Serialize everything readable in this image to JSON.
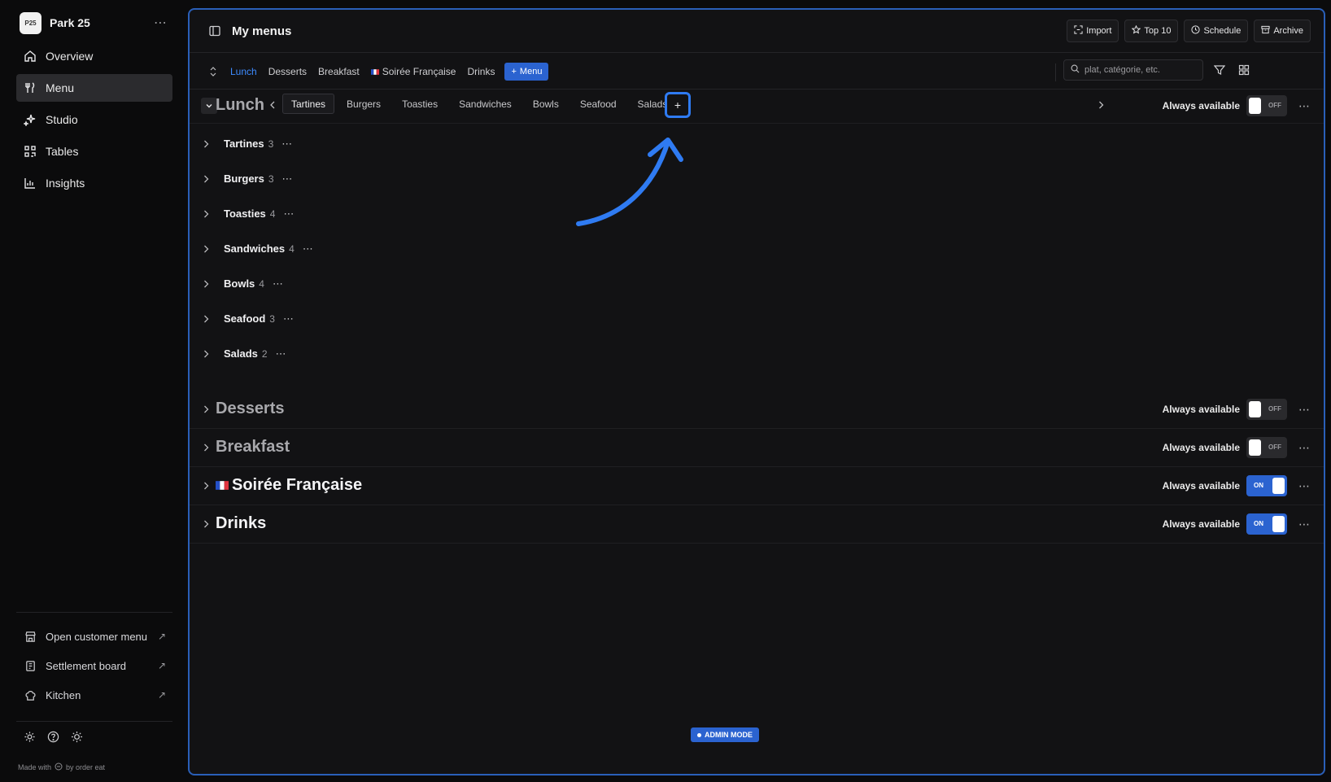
{
  "brand": {
    "name": "Park 25",
    "logo_text": "P25"
  },
  "sidebar": {
    "items": [
      {
        "label": "Overview",
        "icon": "home-icon"
      },
      {
        "label": "Menu",
        "icon": "utensils-icon",
        "active": true
      },
      {
        "label": "Studio",
        "icon": "sparkle-icon"
      },
      {
        "label": "Tables",
        "icon": "qr-icon"
      },
      {
        "label": "Insights",
        "icon": "bar-chart-icon"
      }
    ],
    "links": [
      {
        "label": "Open customer menu",
        "icon": "store-icon"
      },
      {
        "label": "Settlement board",
        "icon": "receipt-icon"
      },
      {
        "label": "Kitchen",
        "icon": "chef-hat-icon"
      }
    ],
    "made_with": "Made with",
    "made_by": "by order eat"
  },
  "header": {
    "title": "My menus",
    "actions": [
      {
        "label": "Import",
        "icon": "import-icon"
      },
      {
        "label": "Top 10",
        "icon": "star-icon"
      },
      {
        "label": "Schedule",
        "icon": "clock-icon"
      },
      {
        "label": "Archive",
        "icon": "archive-icon"
      }
    ]
  },
  "menu_tabs": {
    "items": [
      "Lunch",
      "Desserts",
      "Breakfast",
      "Soirée Française",
      "Drinks"
    ],
    "active": "Lunch",
    "add_label": "Menu"
  },
  "search": {
    "placeholder": "plat, catégorie, etc."
  },
  "lunch": {
    "title": "Lunch",
    "category_tabs": [
      "Tartines",
      "Burgers",
      "Toasties",
      "Sandwiches",
      "Bowls",
      "Seafood",
      "Salads"
    ],
    "active_tab": "Tartines",
    "add_symbol": "+",
    "availability": "Always available",
    "toggle": "OFF",
    "categories": [
      {
        "name": "Tartines",
        "count": "3"
      },
      {
        "name": "Burgers",
        "count": "3"
      },
      {
        "name": "Toasties",
        "count": "4"
      },
      {
        "name": "Sandwiches",
        "count": "4"
      },
      {
        "name": "Bowls",
        "count": "4"
      },
      {
        "name": "Seafood",
        "count": "3"
      },
      {
        "name": "Salads",
        "count": "2"
      }
    ]
  },
  "menus": [
    {
      "title": "Desserts",
      "availability": "Always available",
      "toggle": "OFF"
    },
    {
      "title": "Breakfast",
      "availability": "Always available",
      "toggle": "OFF"
    },
    {
      "title": "Soirée Française",
      "availability": "Always available",
      "toggle": "ON"
    },
    {
      "title": "Drinks",
      "availability": "Always available",
      "toggle": "ON"
    }
  ],
  "admin_badge": "ADMIN MODE",
  "colors": {
    "accent": "#2b63d0",
    "highlight": "#2f7bf2",
    "active_tab_text": "#3d8bff"
  }
}
